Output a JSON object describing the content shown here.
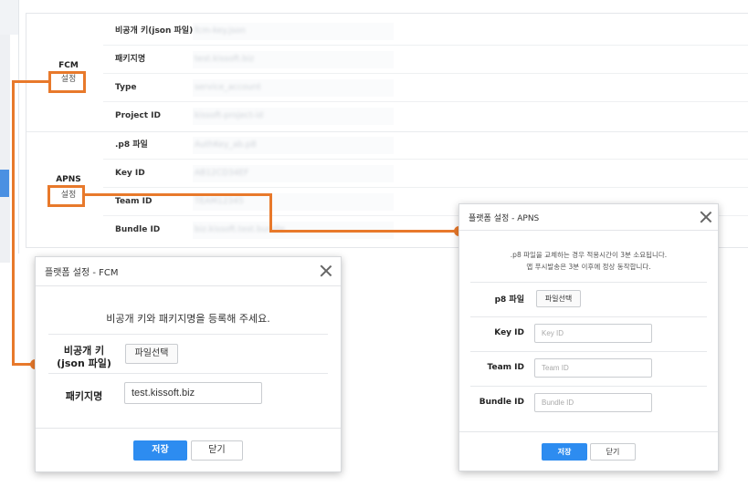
{
  "settings_panel": {
    "fcm": {
      "label": "FCM",
      "setting_button": "설정",
      "rows": [
        {
          "key": "비공개 키(json 파일)",
          "value": "fcm-key.json"
        },
        {
          "key": "패키지명",
          "value": "test.kissoft.biz"
        },
        {
          "key": "Type",
          "value": "service_account"
        },
        {
          "key": "Project ID",
          "value": "kissoft-project-id"
        }
      ]
    },
    "apns": {
      "label": "APNS",
      "setting_button": "설정",
      "rows": [
        {
          "key": ".p8 파일",
          "value": "AuthKey_ab.p8"
        },
        {
          "key": "Key ID",
          "value": "AB12CD34EF"
        },
        {
          "key": "Team ID",
          "value": "TEAM12345"
        },
        {
          "key": "Bundle ID",
          "value": "biz.kissoft.test.bundle"
        }
      ]
    }
  },
  "fcm_modal": {
    "title": "플랫폼 설정 - FCM",
    "instruction": "비공개 키와 패키지명을 등록해 주세요.",
    "private_key_label": "비공개 키",
    "private_key_sublabel": "(json 파일)",
    "file_button": "파일선택",
    "package_label": "패키지명",
    "package_value": "test.kissoft.biz",
    "save_button": "저장",
    "close_button": "닫기"
  },
  "apns_modal": {
    "title": "플랫폼 설정 - APNS",
    "notice_line1": ".p8 파일을 교체하는 경우 적용시간이 3분 소요됩니다.",
    "notice_line2": "앱 푸시발송은 3분 이후에 정상 동작합니다.",
    "p8_label": "p8 파일",
    "file_button": "파일선택",
    "key_id_label": "Key ID",
    "key_id_placeholder": "Key ID",
    "team_id_label": "Team ID",
    "team_id_placeholder": "Team ID",
    "bundle_id_label": "Bundle ID",
    "bundle_id_placeholder": "Bundle ID",
    "save_button": "저장",
    "close_button": "닫기"
  },
  "colors": {
    "callout": "#e8792b",
    "primary": "#2d8cf0",
    "sidebar_accent": "#4a90e2"
  }
}
